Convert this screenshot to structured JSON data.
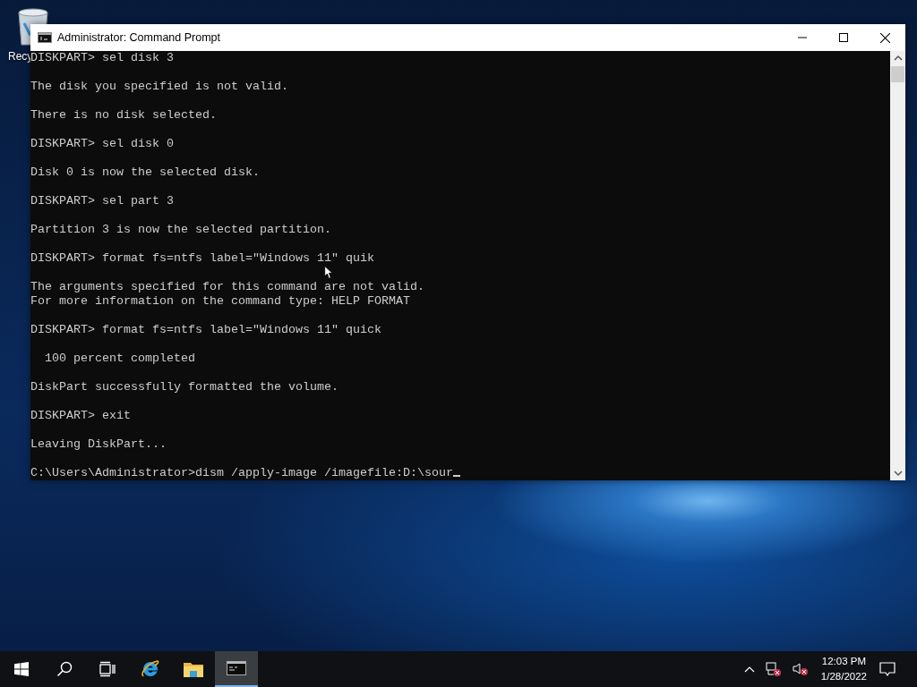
{
  "desktop": {
    "icons": [
      {
        "label": "Recy"
      }
    ]
  },
  "window": {
    "title": "Administrator: Command Prompt",
    "console": {
      "blocks": [
        [
          "DISKPART> sel disk 3"
        ],
        [
          "The disk you specified is not valid."
        ],
        [
          "There is no disk selected."
        ],
        [
          "DISKPART> sel disk 0"
        ],
        [
          "Disk 0 is now the selected disk."
        ],
        [
          "DISKPART> sel part 3"
        ],
        [
          "Partition 3 is now the selected partition."
        ],
        [
          "DISKPART> format fs=ntfs label=\"Windows 11\" quik"
        ],
        [
          "The arguments specified for this command are not valid.",
          "For more information on the command type: HELP FORMAT"
        ],
        [
          "DISKPART> format fs=ntfs label=\"Windows 11\" quick"
        ],
        [
          "  100 percent completed"
        ],
        [
          "DiskPart successfully formatted the volume."
        ],
        [
          "DISKPART> exit"
        ],
        [
          "Leaving DiskPart..."
        ],
        [
          "C:\\Users\\Administrator>dism /apply-image /imagefile:D:\\sour"
        ]
      ]
    }
  },
  "taskbar": {
    "items": [
      {
        "kind": "start",
        "selected": false
      },
      {
        "kind": "search",
        "selected": false
      },
      {
        "kind": "taskview",
        "selected": false
      },
      {
        "kind": "browser",
        "selected": false
      },
      {
        "kind": "folder",
        "selected": false
      },
      {
        "kind": "terminal",
        "selected": true
      }
    ],
    "clock": {
      "time": "12:03 PM",
      "date": "1/28/2022"
    }
  }
}
